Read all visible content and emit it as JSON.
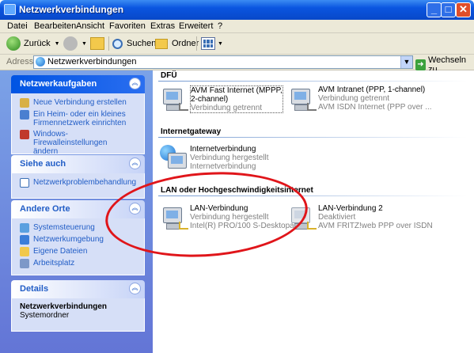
{
  "window": {
    "title": "Netzwerkverbindungen"
  },
  "menu": [
    "Datei",
    "Bearbeiten",
    "Ansicht",
    "Favoriten",
    "Extras",
    "Erweitert",
    "?"
  ],
  "toolbar": {
    "back": "Zurück",
    "search": "Suchen",
    "folders": "Ordner"
  },
  "address": {
    "label": "Adresse",
    "value": "Netzwerkverbindungen",
    "go": "Wechseln zu"
  },
  "sidebar": {
    "network_tasks": {
      "title": "Netzwerkaufgaben",
      "items": [
        "Neue Verbindung erstellen",
        "Ein Heim- oder ein kleines\nFirmennetzwerk einrichten",
        "Windows-Firewalleinstellungen\nändern"
      ]
    },
    "see_also": {
      "title": "Siehe auch",
      "items": [
        "Netzwerkproblembehandlung"
      ]
    },
    "other_places": {
      "title": "Andere Orte",
      "items": [
        "Systemsteuerung",
        "Netzwerkumgebung",
        "Eigene Dateien",
        "Arbeitsplatz"
      ]
    },
    "details": {
      "title": "Details",
      "name": "Netzwerkverbindungen",
      "type": "Systemordner"
    }
  },
  "groups": {
    "dfu": {
      "title": "DFÜ",
      "connections": [
        {
          "name": "AVM Fast Internet (MPPP,\n2-channel)",
          "status": "Verbindung getrennt",
          "device": ""
        },
        {
          "name": "AVM Intranet (PPP, 1-channel)",
          "status": "Verbindung getrennt",
          "device": "AVM ISDN Internet (PPP over ..."
        }
      ]
    },
    "gateway": {
      "title": "Internetgateway",
      "connections": [
        {
          "name": "Internetverbindung",
          "status": "Verbindung hergestellt",
          "device": "Internetverbindung"
        }
      ]
    },
    "lan": {
      "title": "LAN oder Hochgeschwindigkeitsinternet",
      "connections": [
        {
          "name": "LAN-Verbindung",
          "status": "Verbindung hergestellt",
          "device": "Intel(R) PRO/100 S-Desktopa..."
        },
        {
          "name": "LAN-Verbindung 2",
          "status": "Deaktiviert",
          "device": "AVM FRITZ!web PPP over ISDN"
        }
      ]
    }
  },
  "colors": {
    "annotation": "#e0151a",
    "titlebar": "#0a55e0",
    "sidebar": "#7ba2e7"
  }
}
